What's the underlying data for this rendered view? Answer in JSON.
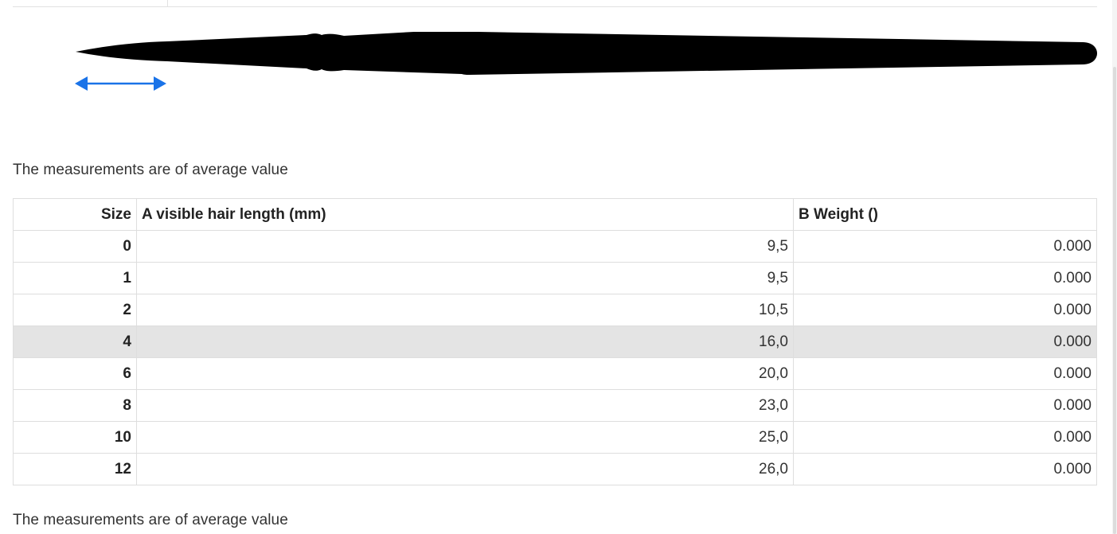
{
  "note_text": "The measurements are of average value",
  "table": {
    "headers": {
      "size": "Size",
      "hair_length": "A visible hair length (mm)",
      "weight": "B Weight ()"
    },
    "rows": [
      {
        "size": "0",
        "hair_length": "9,5",
        "weight": "0.000"
      },
      {
        "size": "1",
        "hair_length": "9,5",
        "weight": "0.000"
      },
      {
        "size": "2",
        "hair_length": "10,5",
        "weight": "0.000"
      },
      {
        "size": "4",
        "hair_length": "16,0",
        "weight": "0.000"
      },
      {
        "size": "6",
        "hair_length": "20,0",
        "weight": "0.000"
      },
      {
        "size": "8",
        "hair_length": "23,0",
        "weight": "0.000"
      },
      {
        "size": "10",
        "hair_length": "25,0",
        "weight": "0.000"
      },
      {
        "size": "12",
        "hair_length": "26,0",
        "weight": "0.000"
      }
    ],
    "highlighted_row": "4"
  },
  "colors": {
    "arrow": "#1a73e8",
    "brush": "#000000",
    "highlight_row": "#e4e4e4"
  }
}
